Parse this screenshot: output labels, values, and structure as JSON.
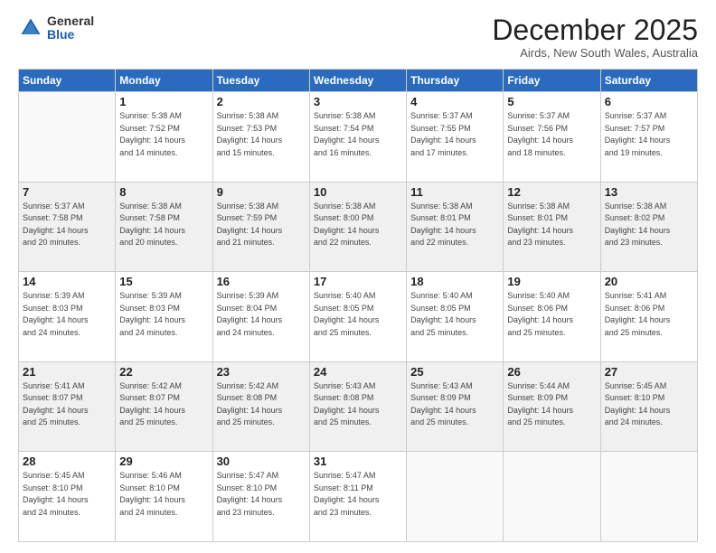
{
  "logo": {
    "general": "General",
    "blue": "Blue"
  },
  "title": "December 2025",
  "subtitle": "Airds, New South Wales, Australia",
  "headers": [
    "Sunday",
    "Monday",
    "Tuesday",
    "Wednesday",
    "Thursday",
    "Friday",
    "Saturday"
  ],
  "weeks": [
    [
      {
        "num": "",
        "detail": ""
      },
      {
        "num": "1",
        "detail": "Sunrise: 5:38 AM\nSunset: 7:52 PM\nDaylight: 14 hours\nand 14 minutes."
      },
      {
        "num": "2",
        "detail": "Sunrise: 5:38 AM\nSunset: 7:53 PM\nDaylight: 14 hours\nand 15 minutes."
      },
      {
        "num": "3",
        "detail": "Sunrise: 5:38 AM\nSunset: 7:54 PM\nDaylight: 14 hours\nand 16 minutes."
      },
      {
        "num": "4",
        "detail": "Sunrise: 5:37 AM\nSunset: 7:55 PM\nDaylight: 14 hours\nand 17 minutes."
      },
      {
        "num": "5",
        "detail": "Sunrise: 5:37 AM\nSunset: 7:56 PM\nDaylight: 14 hours\nand 18 minutes."
      },
      {
        "num": "6",
        "detail": "Sunrise: 5:37 AM\nSunset: 7:57 PM\nDaylight: 14 hours\nand 19 minutes."
      }
    ],
    [
      {
        "num": "7",
        "detail": "Sunrise: 5:37 AM\nSunset: 7:58 PM\nDaylight: 14 hours\nand 20 minutes."
      },
      {
        "num": "8",
        "detail": "Sunrise: 5:38 AM\nSunset: 7:58 PM\nDaylight: 14 hours\nand 20 minutes."
      },
      {
        "num": "9",
        "detail": "Sunrise: 5:38 AM\nSunset: 7:59 PM\nDaylight: 14 hours\nand 21 minutes."
      },
      {
        "num": "10",
        "detail": "Sunrise: 5:38 AM\nSunset: 8:00 PM\nDaylight: 14 hours\nand 22 minutes."
      },
      {
        "num": "11",
        "detail": "Sunrise: 5:38 AM\nSunset: 8:01 PM\nDaylight: 14 hours\nand 22 minutes."
      },
      {
        "num": "12",
        "detail": "Sunrise: 5:38 AM\nSunset: 8:01 PM\nDaylight: 14 hours\nand 23 minutes."
      },
      {
        "num": "13",
        "detail": "Sunrise: 5:38 AM\nSunset: 8:02 PM\nDaylight: 14 hours\nand 23 minutes."
      }
    ],
    [
      {
        "num": "14",
        "detail": "Sunrise: 5:39 AM\nSunset: 8:03 PM\nDaylight: 14 hours\nand 24 minutes."
      },
      {
        "num": "15",
        "detail": "Sunrise: 5:39 AM\nSunset: 8:03 PM\nDaylight: 14 hours\nand 24 minutes."
      },
      {
        "num": "16",
        "detail": "Sunrise: 5:39 AM\nSunset: 8:04 PM\nDaylight: 14 hours\nand 24 minutes."
      },
      {
        "num": "17",
        "detail": "Sunrise: 5:40 AM\nSunset: 8:05 PM\nDaylight: 14 hours\nand 25 minutes."
      },
      {
        "num": "18",
        "detail": "Sunrise: 5:40 AM\nSunset: 8:05 PM\nDaylight: 14 hours\nand 25 minutes."
      },
      {
        "num": "19",
        "detail": "Sunrise: 5:40 AM\nSunset: 8:06 PM\nDaylight: 14 hours\nand 25 minutes."
      },
      {
        "num": "20",
        "detail": "Sunrise: 5:41 AM\nSunset: 8:06 PM\nDaylight: 14 hours\nand 25 minutes."
      }
    ],
    [
      {
        "num": "21",
        "detail": "Sunrise: 5:41 AM\nSunset: 8:07 PM\nDaylight: 14 hours\nand 25 minutes."
      },
      {
        "num": "22",
        "detail": "Sunrise: 5:42 AM\nSunset: 8:07 PM\nDaylight: 14 hours\nand 25 minutes."
      },
      {
        "num": "23",
        "detail": "Sunrise: 5:42 AM\nSunset: 8:08 PM\nDaylight: 14 hours\nand 25 minutes."
      },
      {
        "num": "24",
        "detail": "Sunrise: 5:43 AM\nSunset: 8:08 PM\nDaylight: 14 hours\nand 25 minutes."
      },
      {
        "num": "25",
        "detail": "Sunrise: 5:43 AM\nSunset: 8:09 PM\nDaylight: 14 hours\nand 25 minutes."
      },
      {
        "num": "26",
        "detail": "Sunrise: 5:44 AM\nSunset: 8:09 PM\nDaylight: 14 hours\nand 25 minutes."
      },
      {
        "num": "27",
        "detail": "Sunrise: 5:45 AM\nSunset: 8:10 PM\nDaylight: 14 hours\nand 24 minutes."
      }
    ],
    [
      {
        "num": "28",
        "detail": "Sunrise: 5:45 AM\nSunset: 8:10 PM\nDaylight: 14 hours\nand 24 minutes."
      },
      {
        "num": "29",
        "detail": "Sunrise: 5:46 AM\nSunset: 8:10 PM\nDaylight: 14 hours\nand 24 minutes."
      },
      {
        "num": "30",
        "detail": "Sunrise: 5:47 AM\nSunset: 8:10 PM\nDaylight: 14 hours\nand 23 minutes."
      },
      {
        "num": "31",
        "detail": "Sunrise: 5:47 AM\nSunset: 8:11 PM\nDaylight: 14 hours\nand 23 minutes."
      },
      {
        "num": "",
        "detail": ""
      },
      {
        "num": "",
        "detail": ""
      },
      {
        "num": "",
        "detail": ""
      }
    ]
  ]
}
